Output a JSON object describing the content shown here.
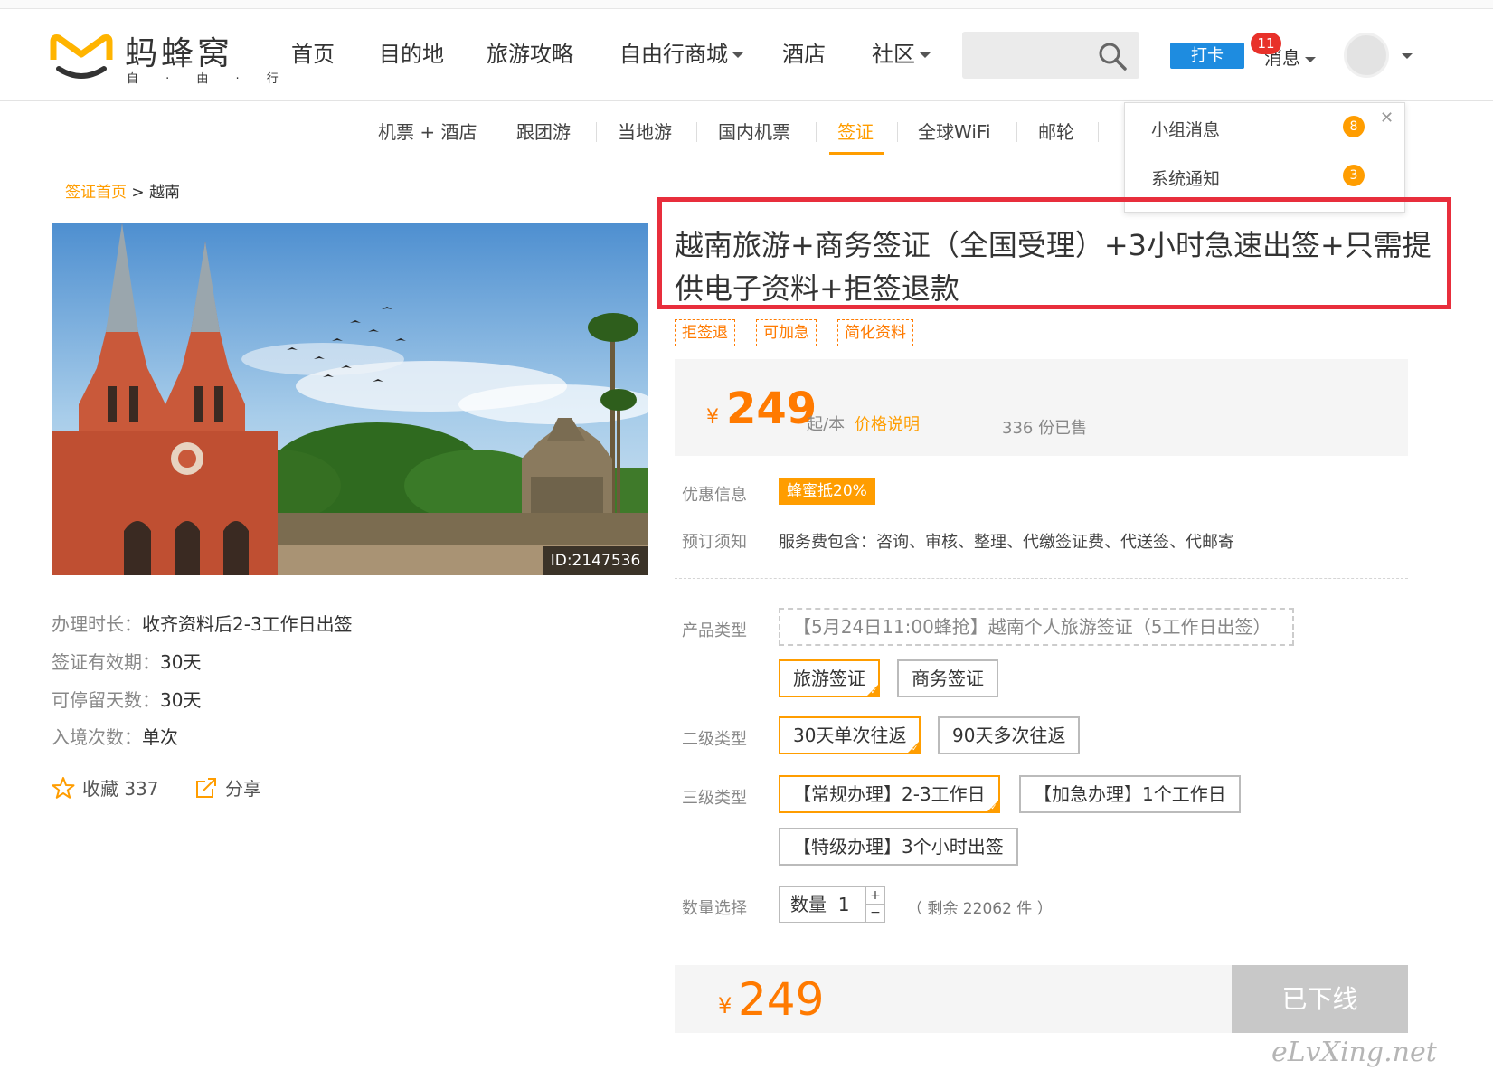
{
  "logo": {
    "name": "蚂蜂窝",
    "sub": "自 · 由 · 行"
  },
  "nav": {
    "home": "首页",
    "destination": "目的地",
    "guides": "旅游攻略",
    "mall": "自由行商城",
    "hotel": "酒店",
    "community": "社区"
  },
  "header": {
    "checkin": "打卡",
    "messages": "消息",
    "messages_badge": "11"
  },
  "subnav": {
    "flight_hotel": "机票 + 酒店",
    "group_tour": "跟团游",
    "local": "当地游",
    "domestic_flight": "国内机票",
    "visa": "签证",
    "wifi": "全球WiFi",
    "cruise": "邮轮"
  },
  "dropdown": {
    "group_msg": "小组消息",
    "group_count": "8",
    "system_msg": "系统通知",
    "system_count": "3"
  },
  "breadcrumb": {
    "home": "签证首页",
    "sep": " > ",
    "current": "越南"
  },
  "hero": {
    "id_tag": "ID:2147536"
  },
  "info": {
    "duration_k": "办理时长：",
    "duration_v": "收齐资料后2-3工作日出签",
    "validity_k": "签证有效期：",
    "validity_v": "30天",
    "stay_k": "可停留天数：",
    "stay_v": "30天",
    "entries_k": "入境次数：",
    "entries_v": "单次"
  },
  "actions": {
    "favorite": "收藏 337",
    "share": "分享"
  },
  "product": {
    "title": "越南旅游+商务签证（全国受理）+3小时急速出签+只需提供电子资料+拒签退款",
    "tags": [
      "拒签退",
      "可加急",
      "简化资料"
    ],
    "currency": "¥",
    "price": "249",
    "per": "起/本",
    "price_note": "价格说明",
    "sold": "336 份已售"
  },
  "promo": {
    "label": "优惠信息",
    "badge": "蜂蜜抵20%"
  },
  "booking": {
    "label": "预订须知",
    "text": "服务费包含：咨询、审核、整理、代缴签证费、代送签、代邮寄"
  },
  "options": {
    "type_label": "产品类型",
    "type_placeholder": "【5月24日11:00蜂抢】越南个人旅游签证（5工作日出签）",
    "type_1": "旅游签证",
    "type_2": "商务签证",
    "level2_label": "二级类型",
    "level2_1": "30天单次往返",
    "level2_2": "90天多次往返",
    "level3_label": "三级类型",
    "level3_1": "【常规办理】2-3工作日",
    "level3_2": "【加急办理】1个工作日",
    "level3_3": "【特级办理】3个小时出签",
    "qty_label": "数量选择",
    "qty_text": "数量",
    "qty_value": "1",
    "plus": "+",
    "minus": "−",
    "remain": "（ 剩余 22062 件 ）"
  },
  "buy": {
    "currency": "¥",
    "price": "249",
    "status": "已下线"
  },
  "watermark": "eLvXing.net",
  "colors": {
    "accent": "#ff9d00",
    "price": "#ff7a00",
    "highlight_box": "#e82e3c",
    "checkin": "#1e8ce0"
  }
}
